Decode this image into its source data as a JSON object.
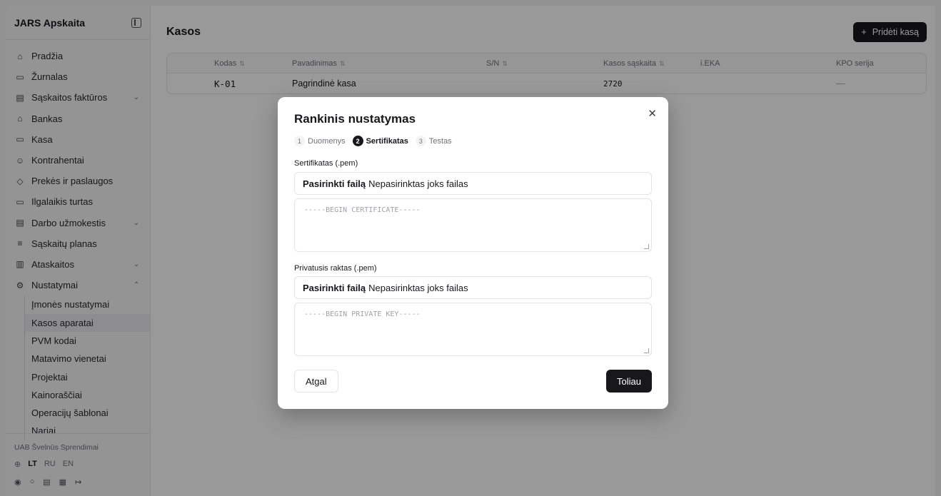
{
  "sidebar": {
    "title": "JARS Apskaita",
    "nav": [
      {
        "icon": "⌂",
        "label": "Pradžia",
        "chevron": ""
      },
      {
        "icon": "▭",
        "label": "Žurnalas",
        "chevron": ""
      },
      {
        "icon": "▤",
        "label": "Sąskaitos faktūros",
        "chevron": "⌄"
      },
      {
        "icon": "⌂",
        "label": "Bankas",
        "chevron": ""
      },
      {
        "icon": "▭",
        "label": "Kasa",
        "chevron": ""
      },
      {
        "icon": "☺",
        "label": "Kontrahentai",
        "chevron": ""
      },
      {
        "icon": "◇",
        "label": "Prekės ir paslaugos",
        "chevron": ""
      },
      {
        "icon": "▭",
        "label": "Ilgalaikis turtas",
        "chevron": ""
      },
      {
        "icon": "▤",
        "label": "Darbo užmokestis",
        "chevron": "⌄"
      },
      {
        "icon": "≡",
        "label": "Sąskaitų planas",
        "chevron": ""
      },
      {
        "icon": "▥",
        "label": "Ataskaitos",
        "chevron": "⌄"
      },
      {
        "icon": "⚙",
        "label": "Nustatymai",
        "chevron": "⌃"
      }
    ],
    "subnav": [
      "Įmonės nustatymai",
      "Kasos aparatai",
      "PVM kodai",
      "Matavimo vienetai",
      "Projektai",
      "Kainoraščiai",
      "Operacijų šablonai",
      "Nariai"
    ],
    "org": "UAB Švelnūs Sprendimai",
    "languages": [
      "LT",
      "RU",
      "EN"
    ]
  },
  "main": {
    "title": "Kasos",
    "add_button": "Pridėti kasą",
    "columns": [
      "Kodas",
      "Pavadinimas",
      "S/N",
      "Kasos sąskaita",
      "i.EKA",
      "KPO serija"
    ],
    "rows": [
      {
        "kodas": "K-01",
        "pavadinimas": "Pagrindinė kasa",
        "sn": "",
        "saskaita": "2720",
        "ieka": "",
        "kpo": "—"
      }
    ]
  },
  "modal": {
    "title": "Rankinis nustatymas",
    "steps": [
      {
        "num": "1",
        "label": "Duomenys"
      },
      {
        "num": "2",
        "label": "Sertifikatas"
      },
      {
        "num": "3",
        "label": "Testas"
      }
    ],
    "cert_label": "Sertifikatas (.pem)",
    "file_button": "Pasirinkti failą",
    "file_status": "Nepasirinktas joks failas",
    "cert_placeholder": "-----BEGIN CERTIFICATE-----",
    "key_label": "Privatusis raktas (.pem)",
    "key_placeholder": "-----BEGIN PRIVATE KEY-----",
    "back_button": "Atgal",
    "next_button": "Toliau"
  }
}
